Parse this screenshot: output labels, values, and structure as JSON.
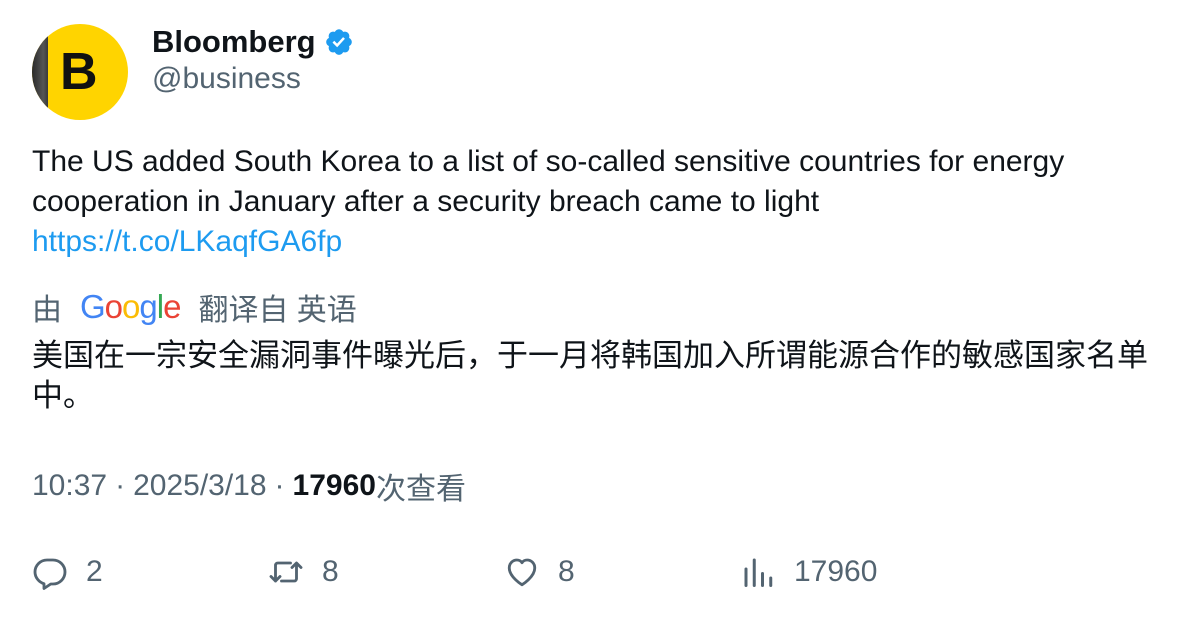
{
  "author": {
    "display_name": "Bloomberg",
    "handle": "@business",
    "avatar_letter": "B",
    "verified": true,
    "verified_color": "#1d9bf0"
  },
  "tweet": {
    "text": "The US added South Korea to a list of so-called sensitive countries for energy cooperation in January after a security breach came to light",
    "link": "https://t.co/LKaqfGA6fp"
  },
  "translation": {
    "prefix": "由",
    "provider": "Google",
    "suffix": "翻译自 英语",
    "text": "美国在一宗安全漏洞事件曝光后，于一月将韩国加入所谓能源合作的敏感国家名单中。"
  },
  "meta": {
    "time": "10:37",
    "separator": "·",
    "date": "2025/3/18",
    "views_count": "17960",
    "views_label": "次查看"
  },
  "actions": {
    "reply": {
      "icon": "reply-icon",
      "count": "2"
    },
    "retweet": {
      "icon": "retweet-icon",
      "count": "8"
    },
    "like": {
      "icon": "heart-icon",
      "count": "8"
    },
    "views": {
      "icon": "views-icon",
      "count": "17960"
    }
  },
  "colors": {
    "text": "#0f1419",
    "secondary": "#536471",
    "link": "#1d9bf0",
    "avatar_bg": "#ffd400"
  }
}
